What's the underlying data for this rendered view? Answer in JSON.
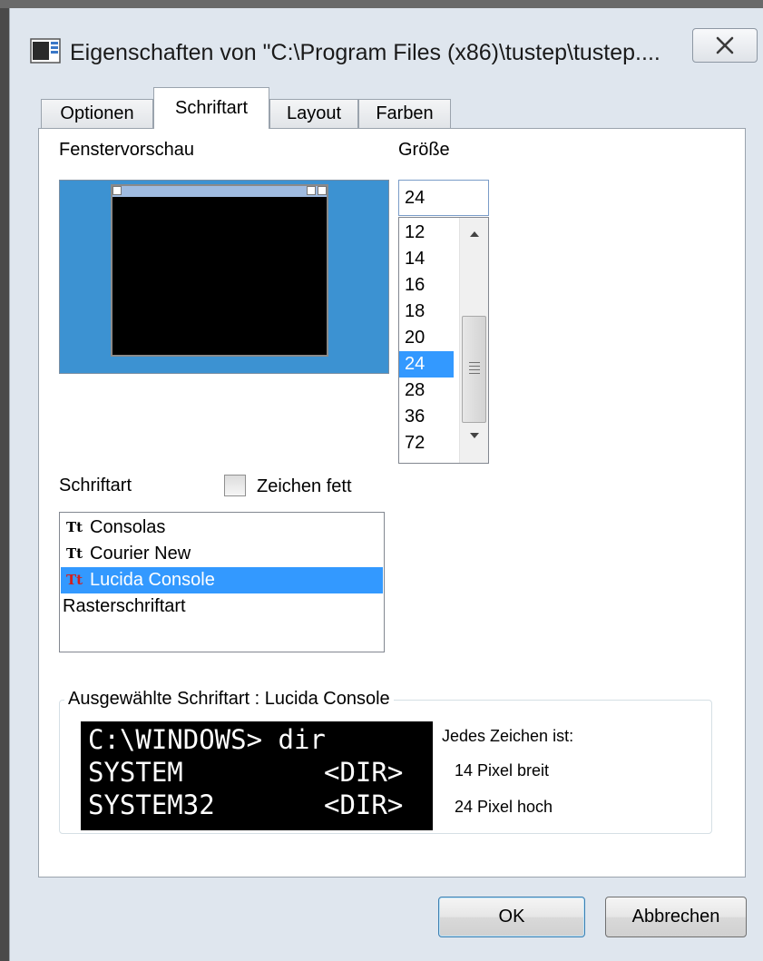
{
  "window": {
    "title": "Eigenschaften von \"C:\\Program Files (x86)\\tustep\\tustep....",
    "close_symbol": "✕"
  },
  "tabs": [
    {
      "label": "Optionen",
      "active": false
    },
    {
      "label": "Schriftart",
      "active": true
    },
    {
      "label": "Layout",
      "active": false
    },
    {
      "label": "Farben",
      "active": false
    }
  ],
  "preview": {
    "label": "Fenstervorschau"
  },
  "size": {
    "label": "Größe",
    "value": "24",
    "options": [
      "12",
      "14",
      "16",
      "18",
      "20",
      "24",
      "28",
      "36",
      "72"
    ],
    "selected": "24"
  },
  "font": {
    "label": "Schriftart",
    "bold_label": "Zeichen fett",
    "bold_checked": false,
    "items": [
      {
        "name": "Consolas",
        "icon": "truetype-icon",
        "selected": false
      },
      {
        "name": "Courier New",
        "icon": "truetype-icon",
        "selected": false
      },
      {
        "name": "Lucida Console",
        "icon": "truetype-icon",
        "selected": true
      },
      {
        "name": "Rasterschriftart",
        "icon": "",
        "selected": false
      }
    ]
  },
  "selected_font": {
    "group_title": "Ausgewählte Schriftart : Lucida Console",
    "sample_lines": [
      {
        "left": "C:\\WINDOWS> dir",
        "right": ""
      },
      {
        "left": "SYSTEM",
        "right": "<DIR>"
      },
      {
        "left": "SYSTEM32",
        "right": "<DIR>"
      }
    ],
    "info_heading": "Jedes Zeichen ist:",
    "width_text": "14 Pixel breit",
    "height_text": "24 Pixel hoch"
  },
  "buttons": {
    "ok": "OK",
    "cancel": "Abbrechen"
  },
  "colors": {
    "selection": "#3399ff",
    "preview_bg": "#3c92d2"
  }
}
